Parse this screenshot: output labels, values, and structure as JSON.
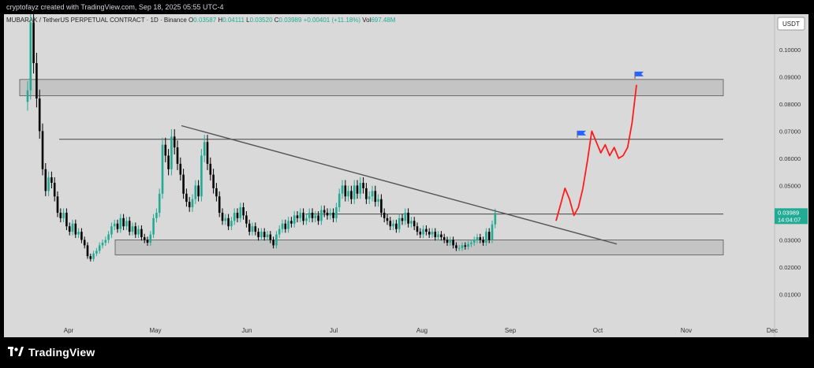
{
  "attribution": "cryptofayz created with TradingView.com, Sep 18, 2025 05:55 UTC-4",
  "symbol": {
    "name": "MUBARAK / TetherUS PERPETUAL CONTRACT · 1D · Binance",
    "o_label": "O",
    "o": "0.03587",
    "h_label": "H",
    "h": "0.04111",
    "l_label": "L",
    "l": "0.03520",
    "c_label": "C",
    "c": "0.03989",
    "change": "+0.00401 (+11.18%)",
    "vol_label": "Vol",
    "vol": "697.48M"
  },
  "currency_button": "USDT",
  "price_badge": {
    "price": "0.03989",
    "countdown": "14:04:07"
  },
  "brand": "TradingView",
  "colors": {
    "up": "#22ab94",
    "down": "#000000",
    "projection": "#ff1b1b",
    "flag": "#2962ff",
    "zone": "#c4c4c4",
    "trendline": "#555555"
  },
  "chart_data": {
    "type": "candlestick",
    "y_ticks": [
      0.01,
      0.02,
      0.03,
      0.04,
      0.05,
      0.06,
      0.07,
      0.08,
      0.09,
      0.1
    ],
    "y_tick_labels": [
      "0.01000",
      "0.02000",
      "0.03000",
      "0.04000",
      "0.05000",
      "0.06000",
      "0.07000",
      "0.08000",
      "0.09000",
      "0.10000"
    ],
    "x_ticks": [
      "Apr",
      "May",
      "Jun",
      "Jul",
      "Aug",
      "Sep",
      "Oct",
      "Nov",
      "Dec"
    ],
    "ylim": [
      0.0,
      0.113
    ],
    "current_price": 0.03989,
    "candles_close": [
      0.085,
      0.11,
      0.095,
      0.082,
      0.07,
      0.056,
      0.048,
      0.053,
      0.051,
      0.046,
      0.04,
      0.038,
      0.04,
      0.035,
      0.033,
      0.036,
      0.032,
      0.033,
      0.03,
      0.028,
      0.024,
      0.023,
      0.025,
      0.026,
      0.028,
      0.029,
      0.03,
      0.032,
      0.035,
      0.036,
      0.034,
      0.038,
      0.035,
      0.037,
      0.033,
      0.035,
      0.032,
      0.034,
      0.031,
      0.03,
      0.029,
      0.032,
      0.038,
      0.04,
      0.047,
      0.065,
      0.061,
      0.056,
      0.068,
      0.064,
      0.058,
      0.054,
      0.047,
      0.044,
      0.042,
      0.045,
      0.05,
      0.046,
      0.061,
      0.066,
      0.058,
      0.054,
      0.049,
      0.046,
      0.04,
      0.037,
      0.038,
      0.035,
      0.037,
      0.04,
      0.038,
      0.042,
      0.039,
      0.036,
      0.033,
      0.035,
      0.033,
      0.031,
      0.033,
      0.031,
      0.032,
      0.03,
      0.028,
      0.032,
      0.034,
      0.036,
      0.034,
      0.037,
      0.036,
      0.039,
      0.038,
      0.04,
      0.037,
      0.038,
      0.04,
      0.038,
      0.039,
      0.037,
      0.041,
      0.04,
      0.039,
      0.04,
      0.038,
      0.042,
      0.047,
      0.05,
      0.046,
      0.048,
      0.045,
      0.05,
      0.047,
      0.051,
      0.049,
      0.045,
      0.046,
      0.048,
      0.044,
      0.045,
      0.04,
      0.038,
      0.037,
      0.035,
      0.036,
      0.034,
      0.038,
      0.037,
      0.04,
      0.036,
      0.037,
      0.035,
      0.033,
      0.032,
      0.034,
      0.033,
      0.032,
      0.033,
      0.031,
      0.032,
      0.031,
      0.03,
      0.029,
      0.03,
      0.028,
      0.027,
      0.027,
      0.028,
      0.0275,
      0.0285,
      0.029,
      0.03,
      0.031,
      0.03,
      0.029,
      0.033,
      0.03,
      0.0357,
      0.0399
    ],
    "candles_start_x": 30,
    "candle_spacing": 3.8,
    "zones": [
      {
        "x_from": "Mar",
        "x_to": "Dec",
        "y_from": 0.083,
        "y_to": 0.089
      },
      {
        "x_from": "Apr",
        "x_to": "Dec",
        "y_from": 0.0245,
        "y_to": 0.03
      }
    ],
    "levels": [
      0.067,
      0.0395
    ],
    "trendline": {
      "from": 0.072,
      "to": 0.0285
    },
    "projection": [
      0.037,
      0.043,
      0.049,
      0.045,
      0.039,
      0.042,
      0.049,
      0.059,
      0.07,
      0.066,
      0.062,
      0.065,
      0.061,
      0.064,
      0.06,
      0.061,
      0.064,
      0.073,
      0.087
    ],
    "flags": [
      0.0693,
      0.091
    ]
  }
}
